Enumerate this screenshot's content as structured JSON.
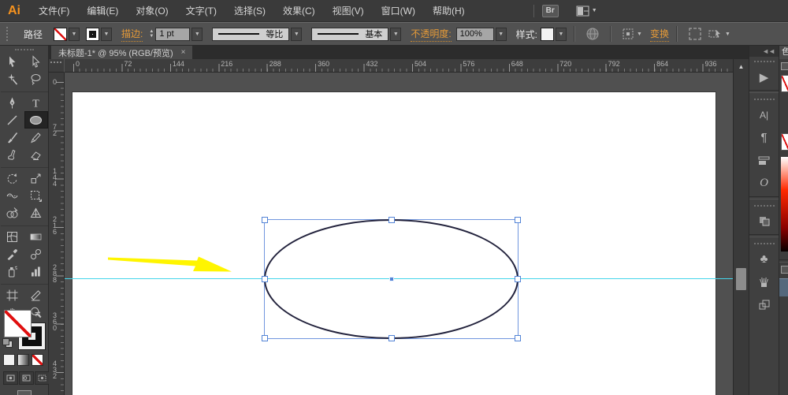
{
  "menu_bar": {
    "logo": "Ai",
    "items": [
      "文件(F)",
      "编辑(E)",
      "对象(O)",
      "文字(T)",
      "选择(S)",
      "效果(C)",
      "视图(V)",
      "窗口(W)",
      "帮助(H)"
    ],
    "bridge_label": "Br"
  },
  "control_bar": {
    "context_label": "路径",
    "stroke_label": "描边:",
    "stroke_weight": "1 pt",
    "width_profile_value": "等比",
    "brush_definition_value": "基本",
    "opacity_label": "不透明度:",
    "opacity_value": "100%",
    "style_label": "样式:",
    "transform_label": "变换"
  },
  "tab_bar": {
    "document_title": "未标题-1* @ 95% (RGB/预览)",
    "close_label": "×"
  },
  "rulers": {
    "horizontal_labels": [
      "0",
      "72",
      "144",
      "216",
      "288",
      "360",
      "432",
      "504",
      "576",
      "648",
      "720",
      "792",
      "864",
      "936"
    ],
    "vertical_labels": [
      "0",
      "72",
      "144",
      "216",
      "288",
      "360",
      "432"
    ]
  },
  "toolbar": {
    "selected_tool": "ellipse-tool",
    "tools": [
      "selection-tool",
      "direct-selection-tool",
      "magic-wand-tool",
      "lasso-tool",
      "pen-tool",
      "type-tool",
      "line-segment-tool",
      "ellipse-tool",
      "paintbrush-tool",
      "pencil-tool",
      "blob-brush-tool",
      "eraser-tool",
      "rotate-tool",
      "scale-tool",
      "width-tool",
      "free-transform-tool",
      "shape-builder-tool",
      "perspective-grid-tool",
      "mesh-tool",
      "gradient-tool",
      "eyedropper-tool",
      "blend-tool",
      "symbol-sprayer-tool",
      "column-graph-tool",
      "artboard-tool",
      "slice-tool",
      "hand-tool",
      "zoom-tool"
    ]
  },
  "right_dock": {
    "collapse_label": "◄◄",
    "panel_icons": [
      "actions-panel",
      "character-panel",
      "paragraph-panel",
      "paragraph-styles-panel",
      "opentype-panel",
      "transparency-panel",
      "symbols-panel",
      "brushes-panel",
      "artboards-panel"
    ],
    "character_glyph": "A|",
    "paragraph_glyph": "¶",
    "opentype_glyph": "O",
    "symbols_glyph": "♣",
    "actions_glyph": "▶"
  },
  "color_panel": {
    "tab_label": "色"
  },
  "canvas": {
    "artboard_color": "#ffffff",
    "guide_color": "#45d6eb",
    "selection_color": "#5283d6",
    "ellipse_stroke_color": "#22223c",
    "annotation_arrow_color": "#fff500"
  }
}
